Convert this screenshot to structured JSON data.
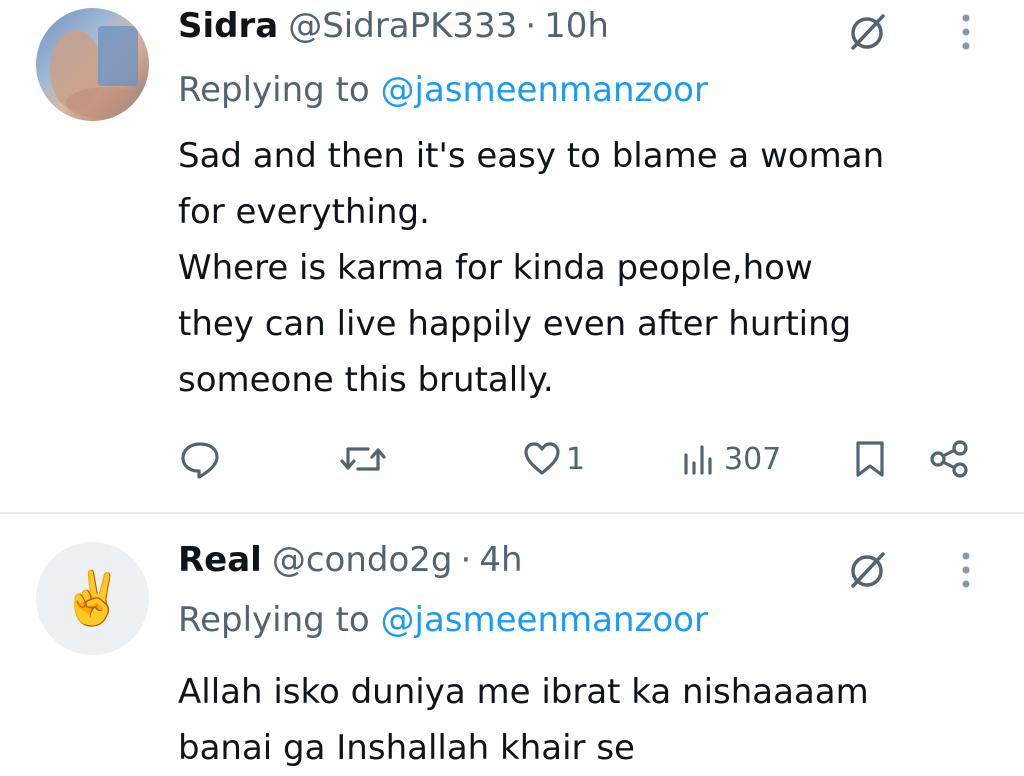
{
  "tweets": [
    {
      "name": "Sidra",
      "handle": "@SidraPK333",
      "separator": "·",
      "time": "10h",
      "replying_prefix": "Replying to",
      "replying_to": "@jasmeenmanzoor",
      "body_lines": [
        "Sad and then it's easy to blame a woman",
        "for everything.",
        "Where is karma for kinda people,how",
        "they can live happily even after hurting",
        "someone this brutally."
      ],
      "likes": "1",
      "views": "307"
    },
    {
      "name": "Real",
      "handle": "@condo2g",
      "separator": "·",
      "time": "4h",
      "replying_prefix": "Replying to",
      "replying_to": "@jasmeenmanzoor",
      "avatar_emoji": "✌️",
      "body_lines": [
        "Allah isko duniya me ibrat ka nishaaaam",
        "banai ga Inshallah khair se"
      ]
    }
  ],
  "icons": {
    "grok": "grok-icon",
    "more": "more-vertical-icon",
    "reply": "reply-icon",
    "repost": "repost-icon",
    "like": "heart-icon",
    "views": "views-chart-icon",
    "bookmark": "bookmark-icon",
    "share": "share-icon"
  },
  "colors": {
    "text": "#0f1419",
    "secondary": "#536471",
    "mention": "#1d9bf0",
    "divider": "#e7e9ea"
  }
}
